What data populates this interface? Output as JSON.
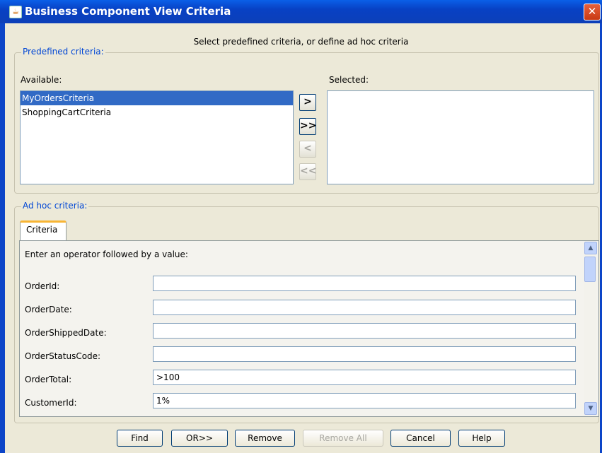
{
  "window": {
    "title": "Business Component View Criteria",
    "close_glyph": "✕"
  },
  "subtitle": "Select predefined criteria, or define ad hoc criteria",
  "predefined": {
    "legend": "Predefined criteria:",
    "available_label": "Available:",
    "selected_label": "Selected:",
    "available_items": [
      "MyOrdersCriteria",
      "ShoppingCartCriteria"
    ],
    "selected_items": [],
    "move_buttons": {
      "add": ">",
      "add_all": ">>",
      "remove": "<",
      "remove_all": "<<"
    }
  },
  "adhoc": {
    "legend": "Ad hoc criteria:",
    "tab_label": "Criteria",
    "instructions": "Enter an operator followed by a value:",
    "fields": [
      {
        "label": "OrderId:",
        "value": ""
      },
      {
        "label": "OrderDate:",
        "value": ""
      },
      {
        "label": "OrderShippedDate:",
        "value": ""
      },
      {
        "label": "OrderStatusCode:",
        "value": ""
      },
      {
        "label": "OrderTotal:",
        "value": ">100"
      },
      {
        "label": "CustomerId:",
        "value": "1%"
      }
    ]
  },
  "buttons": {
    "find": "Find",
    "or": "OR>>",
    "remove": "Remove",
    "remove_all": "Remove All",
    "cancel": "Cancel",
    "help": "Help"
  },
  "colors": {
    "title_bar": "#0a5fe8",
    "legend_text": "#0046d5",
    "selection": "#316ac5",
    "tab_accent": "#f8b534"
  }
}
